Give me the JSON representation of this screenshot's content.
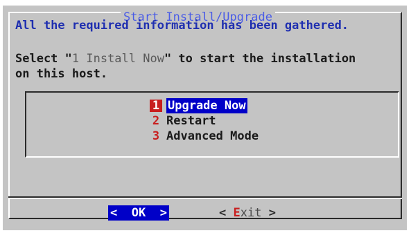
{
  "dialog": {
    "title": "Start Install/Upgrade",
    "line1": "All the required information has been gathered.",
    "line2_prefix": "Select \"",
    "line2_option": "1 Install Now",
    "line2_suffix": "\" to start the installation",
    "line3": "on this host."
  },
  "menu": {
    "items": [
      {
        "number": "1",
        "label": "Upgrade Now",
        "selected": true
      },
      {
        "number": "2",
        "label": "Restart",
        "selected": false
      },
      {
        "number": "3",
        "label": "Advanced Mode",
        "selected": false
      }
    ]
  },
  "buttons": {
    "ok": {
      "left": "<",
      "label": "OK",
      "right": ">"
    },
    "exit": {
      "left": "<",
      "hotkey": "E",
      "rest": "xit",
      "right": ">"
    }
  },
  "colors": {
    "dialog_bg": "#c4c4c4",
    "title": "#4a5ce6",
    "heading": "#1f2fb0",
    "hotkey": "#c81e1e",
    "selection": "#0000c8"
  }
}
